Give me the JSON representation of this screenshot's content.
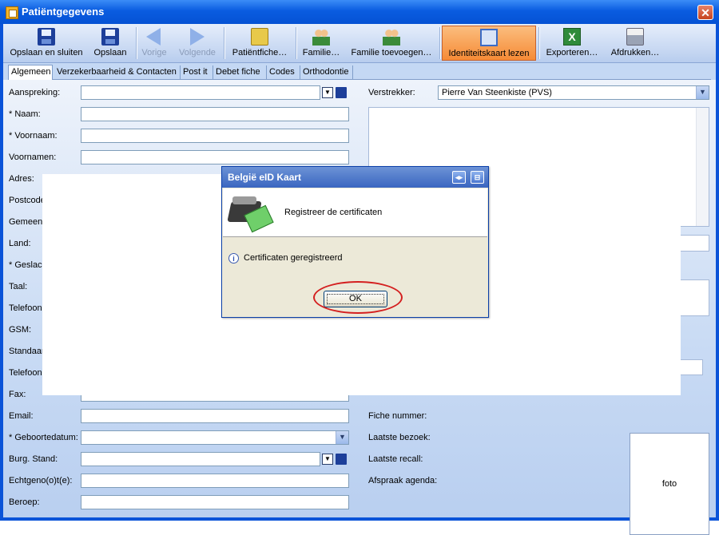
{
  "window": {
    "title": "Patiëntgegevens"
  },
  "toolbar": {
    "buttons": [
      {
        "label": "Opslaan en sluiten",
        "icon": "save-icon"
      },
      {
        "label": "Opslaan",
        "icon": "save-icon"
      },
      {
        "label": "Vorige",
        "icon": "arrow-left-icon",
        "disabled": true
      },
      {
        "label": "Volgende",
        "icon": "arrow-right-icon",
        "disabled": true
      },
      {
        "label": "Patiëntfiche…",
        "icon": "folder-icon"
      },
      {
        "label": "Familie…",
        "icon": "family-icon"
      },
      {
        "label": "Familie toevoegen…",
        "icon": "family-add-icon"
      },
      {
        "label": "Identiteitskaart lezen",
        "icon": "id-card-icon",
        "active": true
      },
      {
        "label": "Exporteren…",
        "icon": "excel-icon"
      },
      {
        "label": "Afdrukken…",
        "icon": "printer-icon"
      }
    ]
  },
  "tabs": [
    "Algemeen",
    "Verzekerbaarheid & Contacten",
    "Post it",
    "Debet fiche",
    "Codes",
    "Orthodontie"
  ],
  "form": {
    "left_labels": [
      "Aanspreking:",
      "* Naam:",
      "* Voornaam:",
      "Voornamen:",
      "Adres:",
      "Postcode",
      "Gemeent",
      "Land:",
      "* Geslach",
      "Taal:",
      "Telefoon",
      "GSM:",
      "Standaar",
      "Telefoon",
      "Fax:",
      "Email:",
      "* Geboortedatum:",
      "Burg. Stand:",
      "Echtgeno(o)t(e):",
      "Beroep:"
    ],
    "verstrekker_label": "Verstrekker:",
    "verstrekker_value": "Pierre Van Steenkiste (PVS)",
    "fiche_labels": [
      "Fiche nummer:",
      "Laatste bezoek:",
      "Laatste recall:",
      "Afspraak agenda:"
    ],
    "foto_label": "foto"
  },
  "dialog": {
    "title": "België eID Kaart",
    "header_message": "Registreer de certificaten",
    "info_message": "Certificaten geregistreerd",
    "ok_label": "OK"
  },
  "colors": {
    "titlebar": "#0a5ce0",
    "active_button": "#f68b36",
    "highlight_circle": "#d42020"
  }
}
